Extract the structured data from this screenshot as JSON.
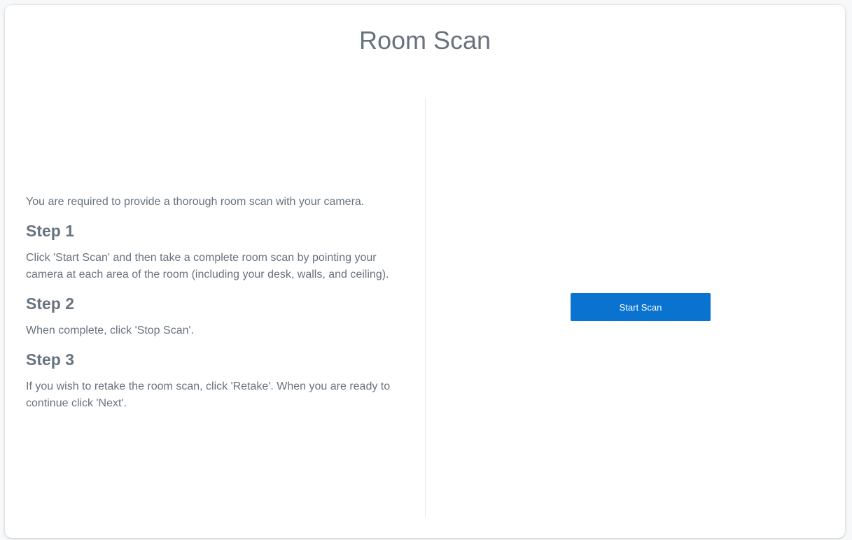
{
  "page": {
    "title": "Room Scan"
  },
  "instructions": {
    "intro": "You are required to provide a thorough room scan with your camera.",
    "steps": [
      {
        "heading": "Step 1",
        "text": "Click 'Start Scan' and then take a complete room scan by pointing your camera at each area of the room (including your desk, walls, and ceiling)."
      },
      {
        "heading": "Step 2",
        "text": "When complete, click 'Stop Scan'."
      },
      {
        "heading": "Step 3",
        "text": "If you wish to retake the room scan, click 'Retake'. When you are ready to continue click 'Next'."
      }
    ]
  },
  "scan": {
    "start_label": "Start Scan"
  },
  "colors": {
    "accent": "#0a73d0",
    "text": "#67737f",
    "divider": "#e4e7ea"
  }
}
